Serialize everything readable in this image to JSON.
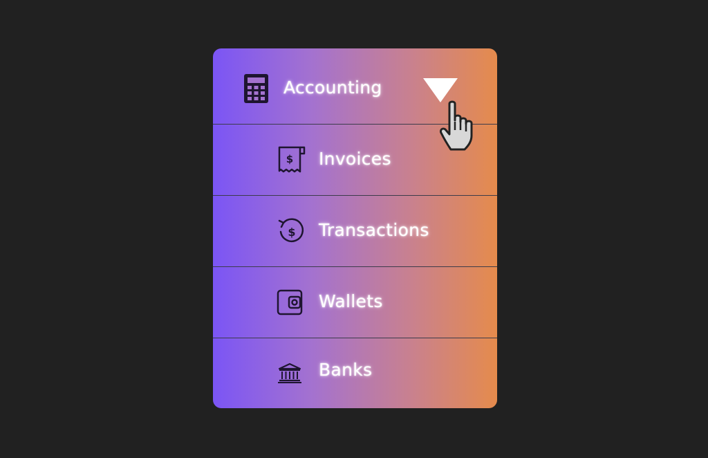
{
  "menu": {
    "header": {
      "label": "Accounting",
      "icon": "calculator-icon"
    },
    "items": [
      {
        "label": "Invoices",
        "icon": "receipt-dollar-icon"
      },
      {
        "label": "Transactions",
        "icon": "dollar-cycle-icon"
      },
      {
        "label": "Wallets",
        "icon": "wallet-icon"
      },
      {
        "label": "Banks",
        "icon": "bank-icon"
      }
    ],
    "expand_icon": "caret-down-icon",
    "cursor": "hand-pointer-cursor"
  },
  "colors": {
    "background": "#212121",
    "gradient_start": "#7b55f5",
    "gradient_end": "#e58b4c",
    "text": "#ffffff",
    "icon": "#1e1530"
  }
}
